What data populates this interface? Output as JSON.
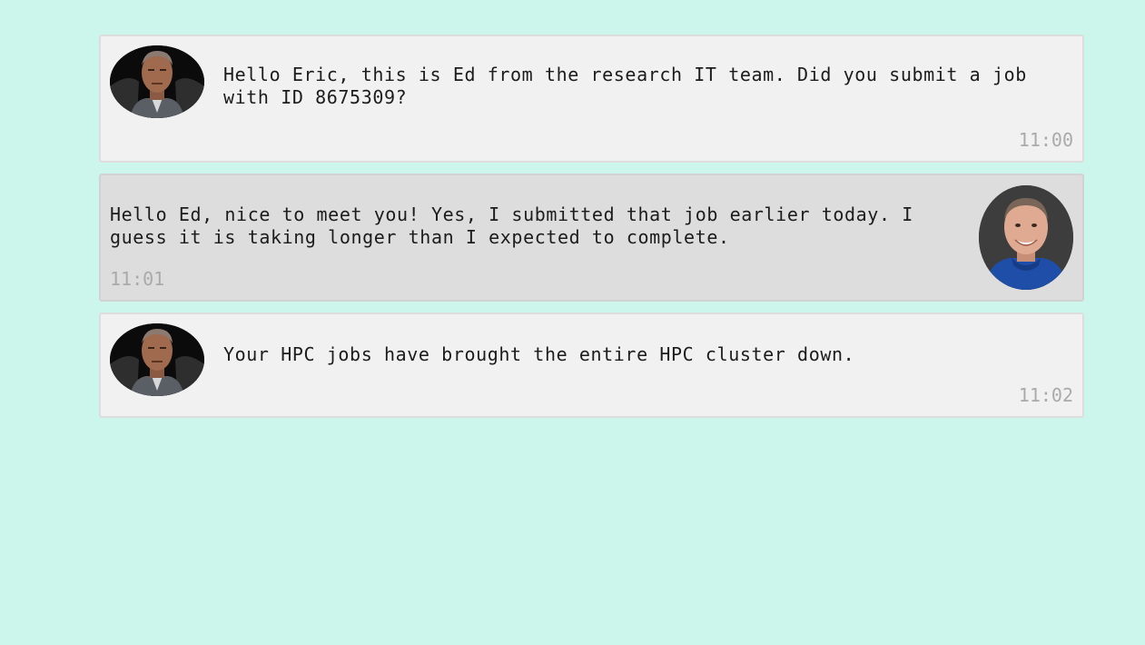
{
  "messages": [
    {
      "sender": "ed",
      "avatar_icon": "ed-avatar",
      "text": "Hello Eric, this is Ed from the research IT team. Did you submit a job with ID 8675309?",
      "time": "11:00"
    },
    {
      "sender": "eric",
      "avatar_icon": "eric-avatar",
      "text": "Hello Ed, nice to meet you! Yes, I submitted that job earlier today. I guess it is taking longer than I expected to complete.",
      "time": "11:01"
    },
    {
      "sender": "ed",
      "avatar_icon": "ed-avatar",
      "text": "Your HPC jobs have brought the entire HPC cluster down.",
      "time": "11:02"
    }
  ],
  "colors": {
    "background": "#ccf5eb",
    "incoming_bubble": "#f1f1f1",
    "outgoing_bubble": "#dddddd",
    "timestamp": "#aaaaaa"
  }
}
